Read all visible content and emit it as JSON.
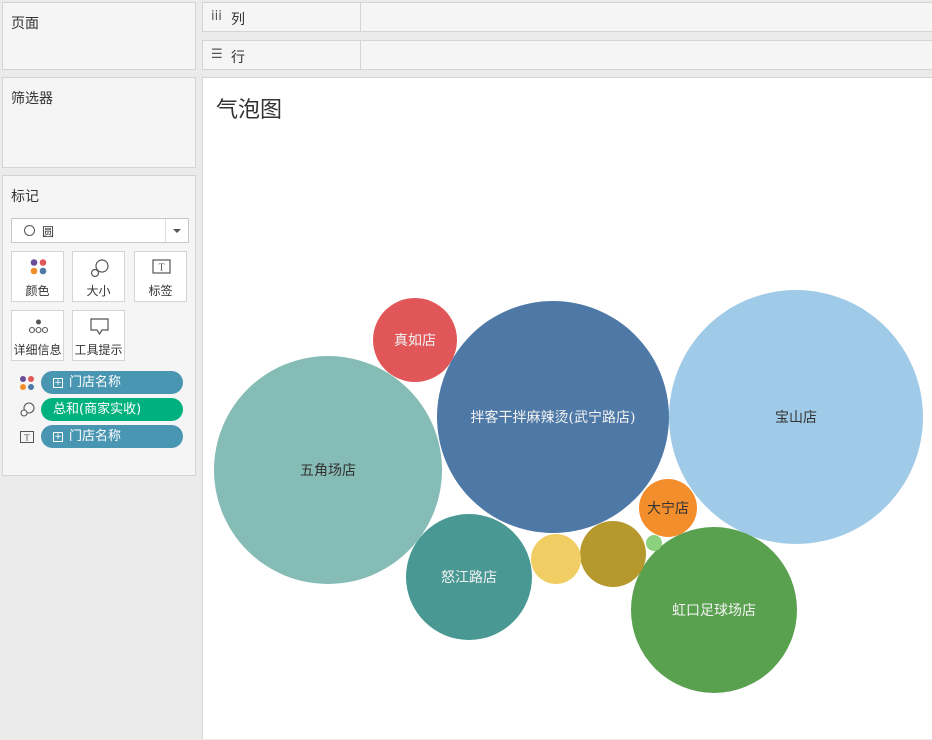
{
  "sidebar": {
    "pages_title": "页面",
    "filters_title": "筛选器",
    "marks_title": "标记",
    "mark_type": "圆",
    "mark_buttons": {
      "color": "颜色",
      "size": "大小",
      "label": "标签",
      "detail": "详细信息",
      "tooltip": "工具提示"
    },
    "pills": [
      {
        "icon": "color-icon",
        "text": "门店名称",
        "type": "dimension"
      },
      {
        "icon": "size-icon",
        "text": "总和(商家实收)",
        "type": "measure"
      },
      {
        "icon": "label-icon",
        "text": "门店名称",
        "type": "dimension"
      }
    ]
  },
  "shelves": {
    "columns_label": "列",
    "rows_label": "行"
  },
  "viz": {
    "title": "气泡图"
  },
  "chart_data": {
    "type": "bubble",
    "title": "气泡图",
    "size_measure": "总和(商家实收)",
    "label_field": "门店名称",
    "bubbles": [
      {
        "label": "宝山店",
        "color": "#a0cbe8"
      },
      {
        "label": "拌客干拌麻辣烫(武宁路店)",
        "color": "#4e79a7"
      },
      {
        "label": "五角场店",
        "color": "#86bcb6"
      },
      {
        "label": "虹口足球场店",
        "color": "#59a14f"
      },
      {
        "label": "怒江路店",
        "color": "#499894"
      },
      {
        "label": "真如店",
        "color": "#e15759"
      },
      {
        "label": "大宁店",
        "color": "#f28e2b"
      },
      {
        "label": "",
        "color": "#b6992d"
      },
      {
        "label": "",
        "color": "#f1ce63"
      },
      {
        "label": "",
        "color": "#8cd17d"
      }
    ]
  }
}
